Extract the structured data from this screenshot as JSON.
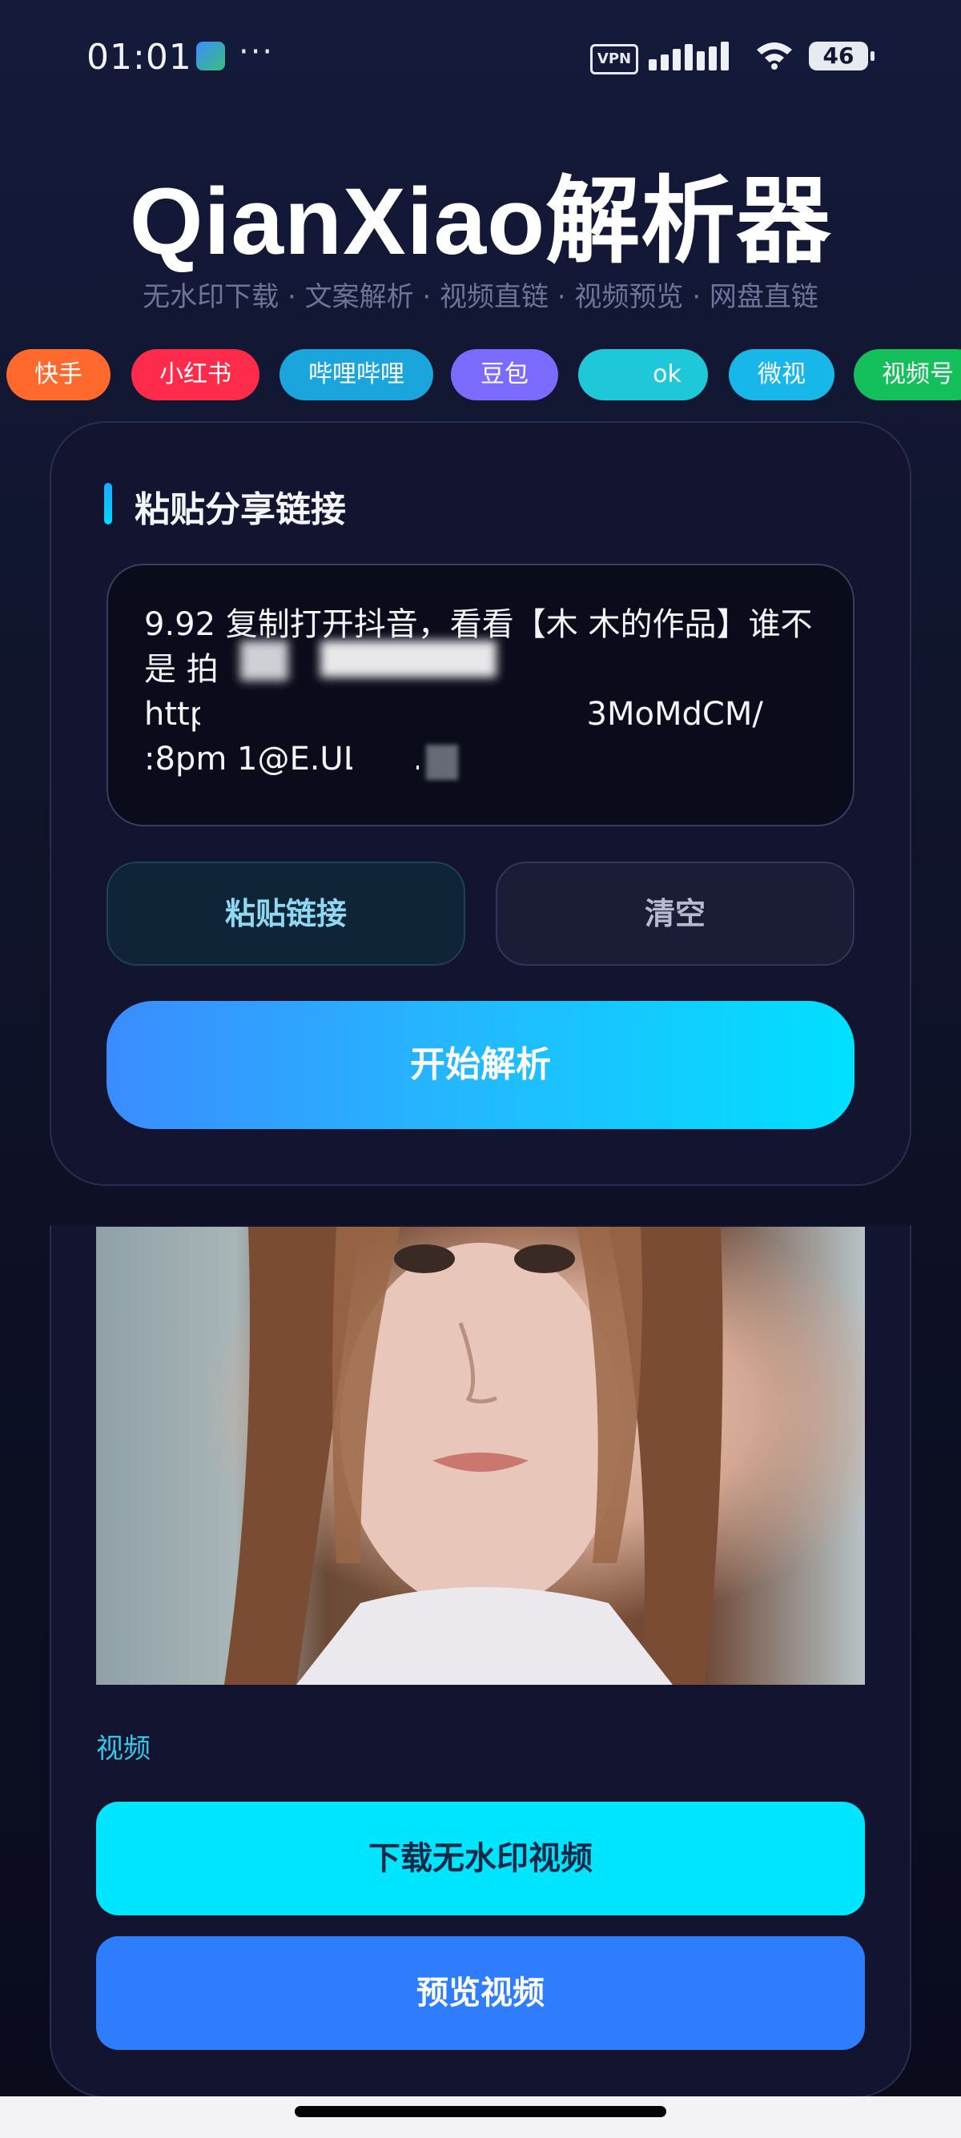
{
  "status_bar": {
    "time": "01:01",
    "more": "···",
    "vpn": "VPN",
    "battery": "46"
  },
  "header": {
    "title": "QianXiao解析器",
    "subtitle": "无水印下载 · 文案解析 · 视频直链 · 视频预览 · 网盘直链"
  },
  "platforms": [
    {
      "label": "快手",
      "color": "#ff6a2c"
    },
    {
      "label": "小红书",
      "color": "#ff2b4a"
    },
    {
      "label": "哔哩哔哩",
      "color": "#1aa5dc"
    },
    {
      "label": "豆包",
      "color": "#7b6bff"
    },
    {
      "label": "ok",
      "color": "#1ec8d8"
    },
    {
      "label": "微视",
      "color": "#17b7ea"
    },
    {
      "label": "视频号",
      "color": "#14c05c"
    }
  ],
  "input_section": {
    "title": "粘贴分享链接",
    "share_text": "9.92 复制打开抖音，看看【木 木的作品】谁不\n是 拍\nhttp                                     3MoMdCM/\n:8pm 1@E.UL 00.",
    "paste_label": "粘贴链接",
    "clear_label": "清空",
    "parse_label": "开始解析"
  },
  "result": {
    "media_label": "视频",
    "download_label": "下载无水印视频",
    "preview_label": "预览视频"
  }
}
